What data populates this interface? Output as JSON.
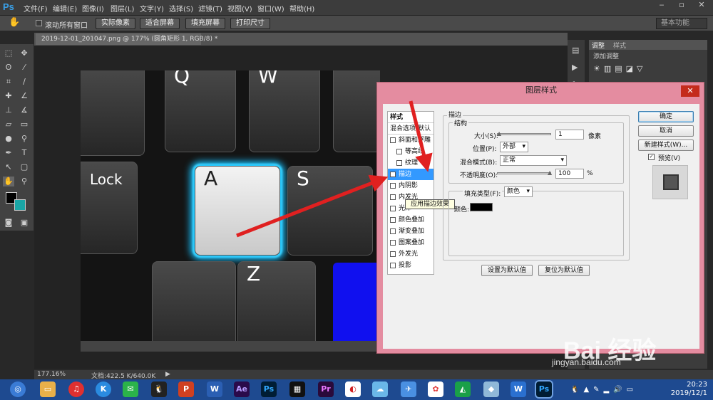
{
  "app": {
    "logo": "Ps"
  },
  "menubar": {
    "items": [
      "文件(F)",
      "编辑(E)",
      "图像(I)",
      "图层(L)",
      "文字(Y)",
      "选择(S)",
      "滤镜(T)",
      "视图(V)",
      "窗口(W)",
      "帮助(H)"
    ],
    "window_controls": [
      "‒",
      "▫",
      "✕"
    ]
  },
  "options_bar": {
    "scroll_all_label": "滚动所有窗口",
    "buttons": [
      "实际像素",
      "适合屏幕",
      "填充屏幕",
      "打印尺寸"
    ],
    "workspace": "基本功能"
  },
  "document": {
    "tab_title": "2019-12-01_201047.png @ 177% (圆角矩形 1, RGB/8) *",
    "keys": {
      "q": "Q",
      "w": "W",
      "a": "A",
      "s": "S",
      "z": "Z",
      "lock": "Lock"
    }
  },
  "status": {
    "zoom": "177.16%",
    "doc_size": "文档:422.5 K/640.0K"
  },
  "right_panel": {
    "tabs": [
      "调整",
      "样式"
    ],
    "add_adjustment": "添加调整"
  },
  "dialog": {
    "title": "图层样式",
    "close": "✕",
    "styles_header": "样式",
    "blending_default": "混合选项:默认",
    "style_items": [
      {
        "label": "斜面和浮雕",
        "checked": false
      },
      {
        "label": "等高线",
        "checked": false
      },
      {
        "label": "纹理",
        "checked": false
      },
      {
        "label": "描边",
        "checked": true
      },
      {
        "label": "内阴影",
        "checked": false
      },
      {
        "label": "内发光",
        "checked": false
      },
      {
        "label": "光泽",
        "checked": false
      },
      {
        "label": "颜色叠加",
        "checked": false
      },
      {
        "label": "渐变叠加",
        "checked": false
      },
      {
        "label": "图案叠加",
        "checked": false
      },
      {
        "label": "外发光",
        "checked": false
      },
      {
        "label": "投影",
        "checked": false
      }
    ],
    "tooltip": "应用描边效果",
    "stroke": {
      "group_title": "描边",
      "structure_title": "结构",
      "size_label": "大小(S):",
      "size_value": "1",
      "size_unit": "像素",
      "size_slider_fraction": 0.01,
      "position_label": "位置(P):",
      "position_value": "外部",
      "blend_mode_label": "混合模式(B):",
      "blend_mode_value": "正常",
      "opacity_label": "不透明度(O):",
      "opacity_value": "100",
      "opacity_unit": "%",
      "opacity_slider_fraction": 1.0,
      "fill_type_label": "填充类型(F):",
      "fill_type_value": "颜色",
      "color_label": "颜色:",
      "color": "#000000",
      "make_default": "设置为默认值",
      "reset_default": "复位为默认值"
    },
    "buttons": {
      "ok": "确定",
      "cancel": "取消",
      "new_style": "新建样式(W)...",
      "preview": "预览(V)",
      "preview_checked": true
    }
  },
  "taskbar": {
    "icons": [
      "Ae",
      "Ps",
      "Pr",
      "Ps"
    ],
    "time": "20:23",
    "date": "2019/12/1"
  },
  "watermark": {
    "brand": "Bai 经验",
    "url": "jingyan.baidu.com"
  },
  "colors": {
    "accent_glow": "#18c2ff",
    "dialog_frame": "#e48ca0",
    "selection": "#3399ff",
    "arrow": "#e02020"
  }
}
